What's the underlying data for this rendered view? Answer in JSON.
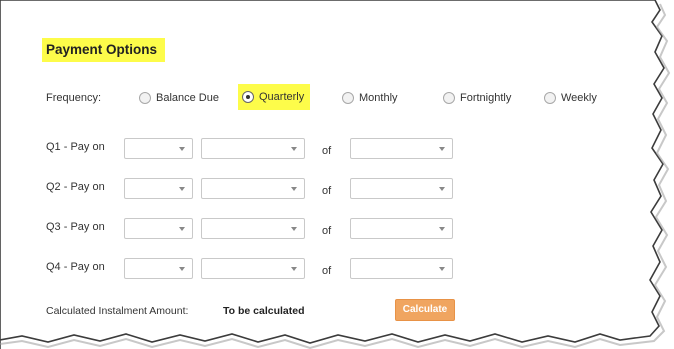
{
  "payment_options": {
    "title": "Payment Options",
    "frequency": {
      "label": "Frequency:",
      "options": [
        {
          "label": "Balance Due",
          "selected": false
        },
        {
          "label": "Quarterly",
          "selected": true
        },
        {
          "label": "Monthly",
          "selected": false
        },
        {
          "label": "Fortnightly",
          "selected": false
        },
        {
          "label": "Weekly",
          "selected": false
        }
      ]
    },
    "schedule": [
      {
        "label": "Q1 - Pay on",
        "of": "of"
      },
      {
        "label": "Q2 - Pay on",
        "of": "of"
      },
      {
        "label": "Q3 - Pay on",
        "of": "of"
      },
      {
        "label": "Q4 - Pay on",
        "of": "of"
      }
    ],
    "instalment": {
      "label": "Calculated Instalment Amount:",
      "value": "To be calculated",
      "button_label": "Calculate"
    }
  },
  "colors": {
    "highlight": "#fdfc4a",
    "calculate_button": "#f0a560"
  }
}
